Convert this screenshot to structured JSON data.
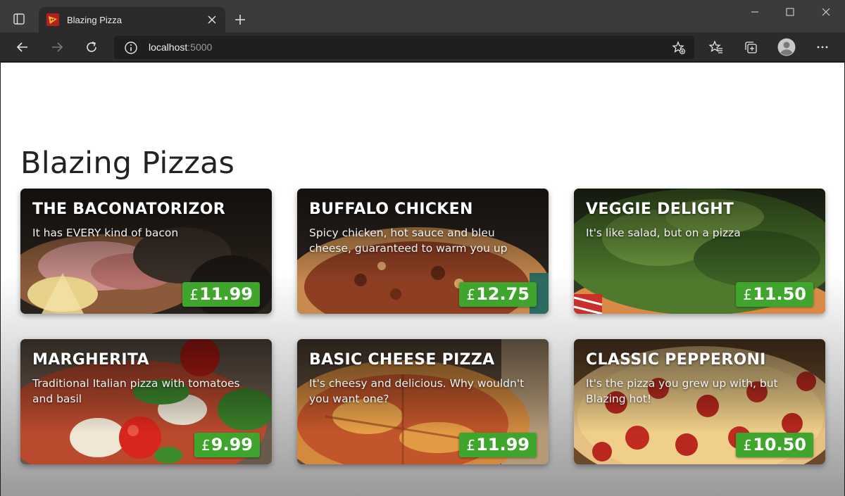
{
  "browser": {
    "tab_title": "Blazing Pizza",
    "url_host": "localhost",
    "url_port": ":5000"
  },
  "page": {
    "heading": "Blazing Pizzas"
  },
  "specials": [
    {
      "name": "THE BACONATORIZOR",
      "description": "It has EVERY kind of bacon",
      "currency": "£",
      "price": "11.99",
      "theme": "bacon"
    },
    {
      "name": "BUFFALO CHICKEN",
      "description": "Spicy chicken, hot sauce and bleu cheese, guaranteed to warm you up",
      "currency": "£",
      "price": "12.75",
      "theme": "buffalo"
    },
    {
      "name": "VEGGIE DELIGHT",
      "description": "It's like salad, but on a pizza",
      "currency": "£",
      "price": "11.50",
      "theme": "veggie"
    },
    {
      "name": "MARGHERITA",
      "description": "Traditional Italian pizza with tomatoes and basil",
      "currency": "£",
      "price": "9.99",
      "theme": "margherita"
    },
    {
      "name": "BASIC CHEESE PIZZA",
      "description": "It's cheesy and delicious. Why wouldn't you want one?",
      "currency": "£",
      "price": "11.99",
      "theme": "cheese"
    },
    {
      "name": "CLASSIC PEPPERONI",
      "description": "It's the pizza you grew up with, but Blazing hot!",
      "currency": "£",
      "price": "10.50",
      "theme": "pepperoni"
    }
  ],
  "colors": {
    "price_badge": "#3fa52c",
    "titlebar": "#3b3b3b",
    "toolbar": "#2b2b2b"
  }
}
